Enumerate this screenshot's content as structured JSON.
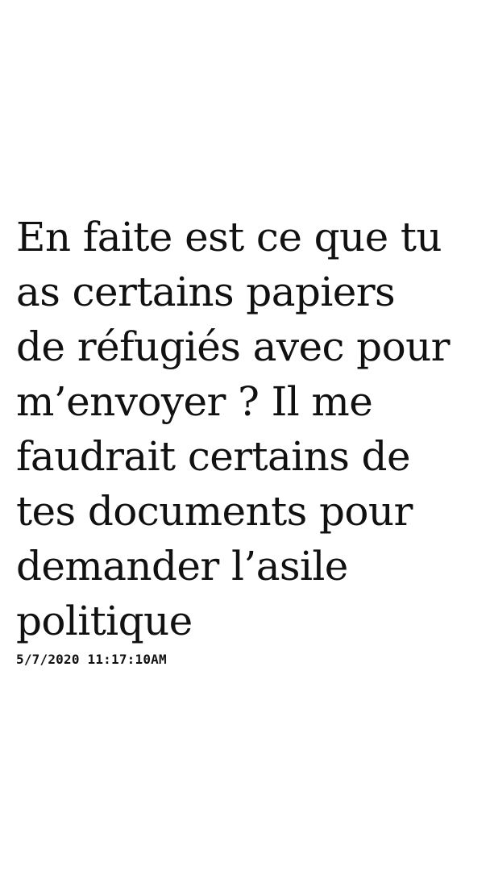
{
  "message": {
    "text": "En faite est ce que tu\nas certains papiers\nde réfugiés avec pour\nm’envoyer ? Il me\nfaudrait certains de\ntes documents pour\ndemander l’asile\npolitique",
    "timestamp": "5/7/2020 11:17:10AM"
  },
  "colors": {
    "background": "#ffffff",
    "text": "#111111"
  }
}
